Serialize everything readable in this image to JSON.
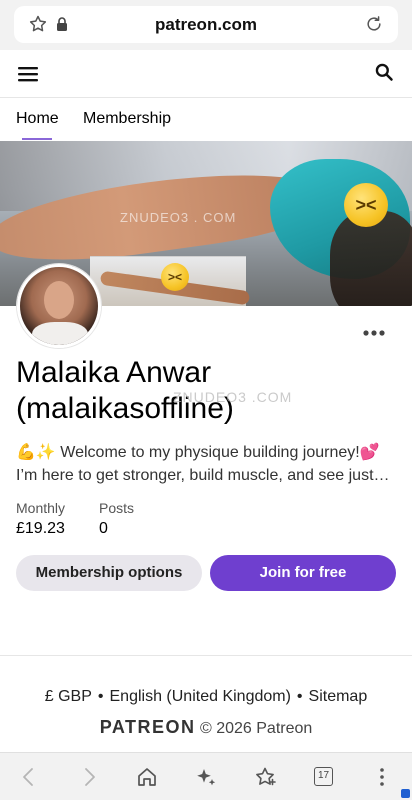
{
  "browser": {
    "url": "patreon.com",
    "tab_count": "17"
  },
  "nav": {
    "tabs": [
      {
        "label": "Home"
      },
      {
        "label": "Membership"
      }
    ]
  },
  "banner": {
    "watermark": "ZNUDEO3 . COM"
  },
  "creator": {
    "name": "Malaika Anwar (malaikasoffline)",
    "name_watermark": "ZNUDEO3 .COM",
    "bio_line1": "💪✨ Welcome to my physique building journey!💕",
    "bio_line2": "I’m here to get stronger, build muscle, and see just…"
  },
  "stats": {
    "monthly_label": "Monthly",
    "monthly_value": "£19.23",
    "posts_label": "Posts",
    "posts_value": "0"
  },
  "actions": {
    "options_label": "Membership options",
    "join_label": "Join for free"
  },
  "footer": {
    "currency": "£ GBP",
    "language": "English (United Kingdom)",
    "sitemap": "Sitemap",
    "brand": "PATREON",
    "copyright": "© 2026 Patreon"
  },
  "colors": {
    "join_button": "#6f3fcf",
    "tab_underline": "#8a67d8"
  }
}
